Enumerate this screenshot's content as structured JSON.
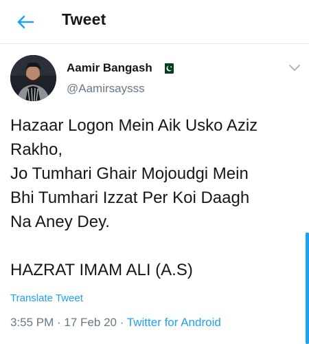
{
  "header": {
    "title": "Tweet",
    "back_icon": "arrow-left-icon",
    "accent_color": "#1da1f2"
  },
  "author": {
    "name": "Aamir Bangash",
    "handle": "@Aamirsaysss",
    "flag_icon": "pakistan-flag-icon",
    "avatar_icon": "profile-photo"
  },
  "menu_icon": "chevron-down-icon",
  "tweet": {
    "lines": [
      "Hazaar Logon Mein Aik Usko Aziz",
      "Rakho,",
      "Jo Tumhari Ghair Mojoudgi Mein",
      "Bhi Tumhari Izzat Per Koi Daagh",
      "Na Aney Dey.",
      "",
      "HAZRAT IMAM ALI (A.S)"
    ]
  },
  "translate_label": "Translate Tweet",
  "meta": {
    "time": "3:55 PM",
    "separator": " · ",
    "date": "17 Feb 20",
    "source": "Twitter for Android"
  },
  "colors": {
    "text": "#14171a",
    "secondary": "#657786",
    "link": "#1da1f2"
  }
}
